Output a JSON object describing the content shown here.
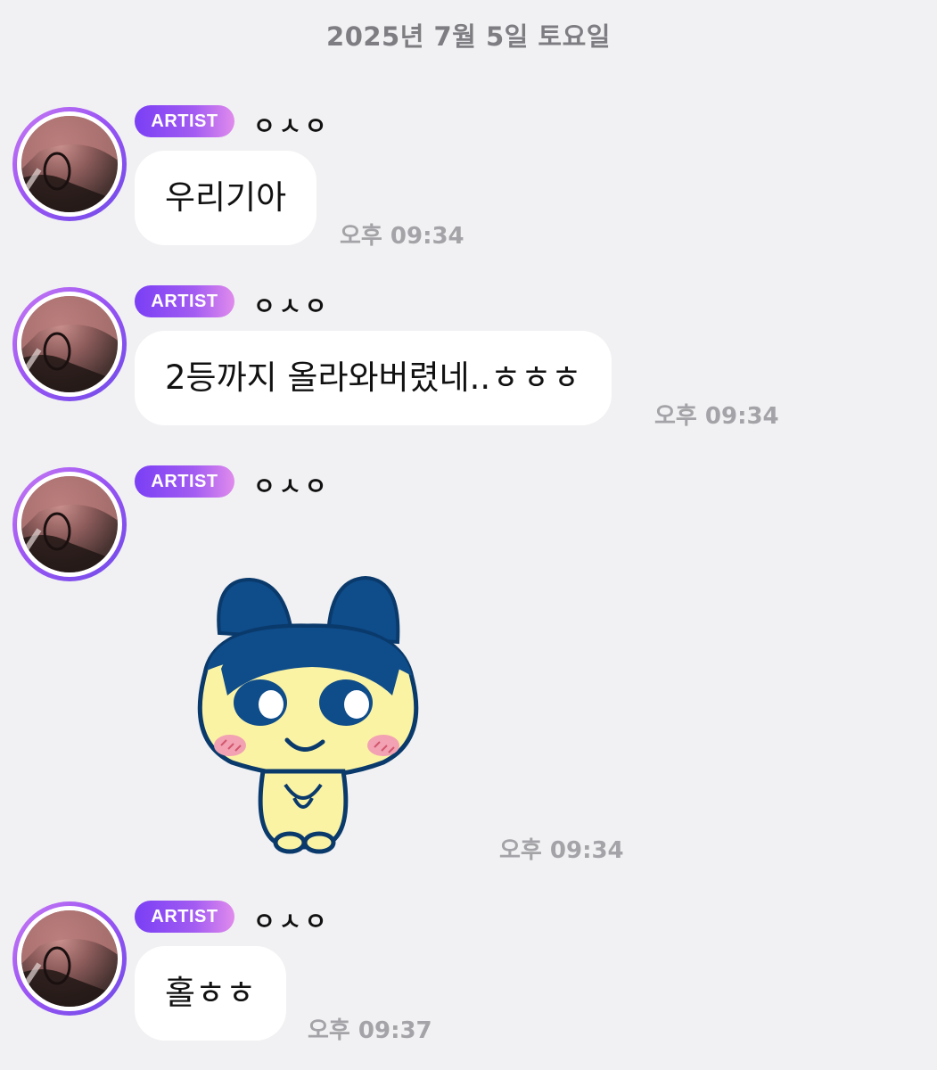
{
  "chat": {
    "date_header": "2025년 7월 5일 토요일",
    "messages": [
      {
        "badge": "ARTIST",
        "sender": "ㅇㅅㅇ",
        "type": "text",
        "text": "우리기아",
        "time": "오후 09:34"
      },
      {
        "badge": "ARTIST",
        "sender": "ㅇㅅㅇ",
        "type": "text",
        "text": "2등까지 올라와버렸네..ㅎㅎㅎ",
        "time": "오후 09:34"
      },
      {
        "badge": "ARTIST",
        "sender": "ㅇㅅㅇ",
        "type": "sticker",
        "sticker": "bunny-mascot-sticker",
        "time": "오후 09:34"
      },
      {
        "badge": "ARTIST",
        "sender": "ㅇㅅㅇ",
        "type": "text",
        "text": "홀ㅎㅎ",
        "time": "오후 09:37"
      }
    ]
  },
  "colors": {
    "background": "#f1f1f3",
    "bubble": "#ffffff",
    "badge_gradient_start": "#7a3ff5",
    "badge_gradient_end": "#e08bec",
    "timestamp": "#a4a4a8",
    "sticker_blue": "#0f4c8a",
    "sticker_yellow": "#fbf3a4"
  }
}
